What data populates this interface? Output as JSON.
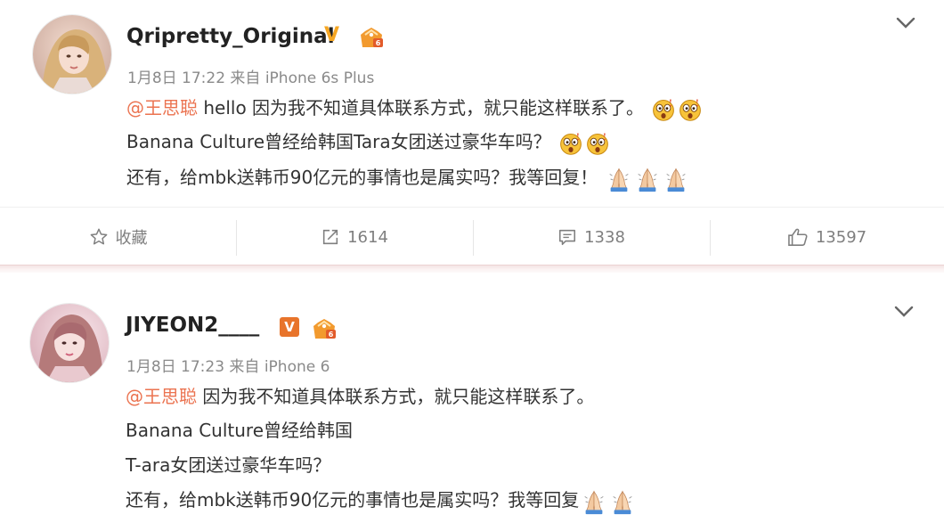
{
  "posts": [
    {
      "username": "Qripretty_Original",
      "verified_mark": "V",
      "meta": "1月8日 17:22 来自 iPhone 6s Plus",
      "mention": "@王思聪",
      "line1_rest": " hello 因为我不知道具体联系方式，就只能这样联系了。",
      "line2": "Banana Culture曾经给韩国Tara女团送过豪华车吗？",
      "line3": "还有，给mbk送韩币90亿元的事情也是属实吗？我等回复！",
      "emojis": [
        "shocked-face-emoji",
        "shocked-face-emoji",
        "shocked-face-emoji",
        "shocked-face-emoji",
        "praying-hands-emoji",
        "praying-hands-emoji",
        "praying-hands-emoji"
      ],
      "actions": {
        "favorite_label": "收藏",
        "repost_count": "1614",
        "comment_count": "1338",
        "like_count": "13597"
      }
    },
    {
      "username": "JIYEON2____",
      "verified_mark": "V",
      "meta": "1月8日 17:23 来自 iPhone 6",
      "mention": "@王思聪",
      "line1_rest": " 因为我不知道具体联系方式，就只能这样联系了。",
      "line2": "Banana Culture曾经给韩国",
      "line3": "T-ara女团送过豪华车吗？",
      "line4": "还有，给mbk送韩币90亿元的事情也是属实吗？我等回复",
      "emojis": [
        "praying-hands-emoji",
        "praying-hands-emoji"
      ]
    }
  ],
  "colors": {
    "mention": "#eb7350",
    "gold_v": "#f5a623",
    "orange_v": "#e8742b",
    "meta_gray": "#8a8a8a"
  }
}
